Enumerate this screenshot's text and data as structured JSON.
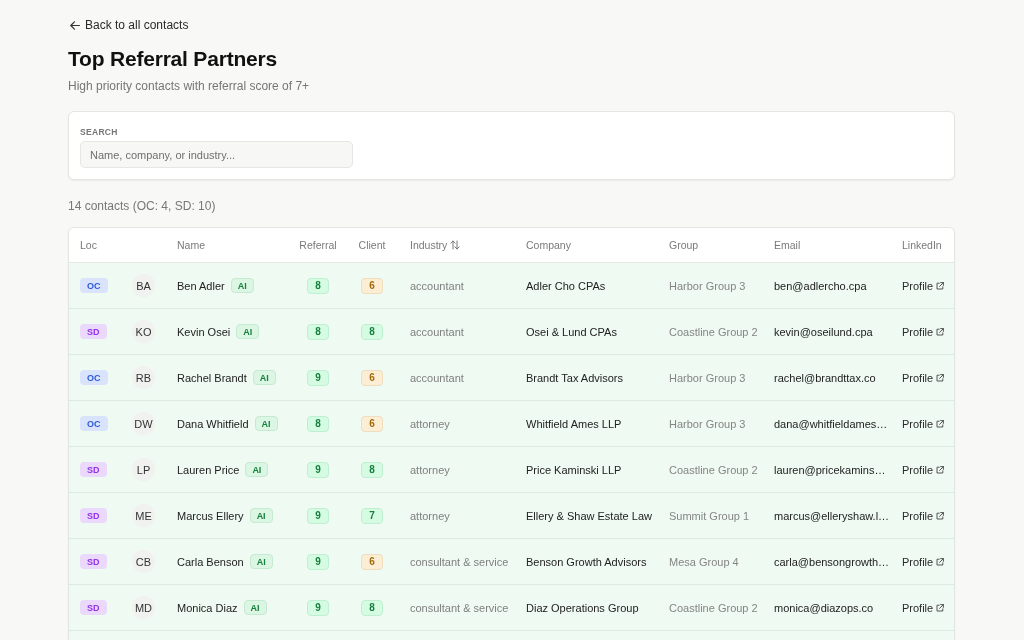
{
  "back_link": {
    "label": "Back to all contacts"
  },
  "title": "Top Referral Partners",
  "subtitle": "High priority contacts with referral score of 7+",
  "search": {
    "label": "SEARCH",
    "placeholder": "Name, company, or industry..."
  },
  "count": "14 contacts (OC: 4, SD: 10)",
  "table": {
    "columns": [
      {
        "label": "Loc",
        "sortable": false
      },
      {
        "label": "Name",
        "sortable": false
      },
      {
        "label": "Referral",
        "sortable": false
      },
      {
        "label": "Client",
        "sortable": false
      },
      {
        "label": "Industry",
        "sortable": true
      },
      {
        "label": "Company",
        "sortable": false
      },
      {
        "label": "Group",
        "sortable": false
      },
      {
        "label": "Email",
        "sortable": false
      },
      {
        "label": "LinkedIn",
        "sortable": false
      }
    ],
    "rows": [
      {
        "loc": {
          "text": "OC",
          "color": "#2d5bd8"
        },
        "initials": "BA",
        "name": "Ben Adler",
        "tag": "AI",
        "referral": {
          "value": "8",
          "color": "#17803d"
        },
        "client": {
          "value": "6",
          "color": "#a26a0a"
        },
        "industry": "accountant",
        "company": "Adler Cho CPAs",
        "group": "Harbor Group 3",
        "email": "ben@adlercho.cpa",
        "linkedin": "Profile"
      },
      {
        "loc": {
          "text": "SD",
          "color": "#9333ea"
        },
        "initials": "KO",
        "name": "Kevin Osei",
        "tag": "AI",
        "referral": {
          "value": "8",
          "color": "#17803d"
        },
        "client": {
          "value": "8",
          "color": "#17803d"
        },
        "industry": "accountant",
        "company": "Osei & Lund CPAs",
        "group": "Coastline Group 2",
        "email": "kevin@oseilund.cpa",
        "linkedin": "Profile"
      },
      {
        "loc": {
          "text": "OC",
          "color": "#2d5bd8"
        },
        "initials": "RB",
        "name": "Rachel Brandt",
        "tag": "AI",
        "referral": {
          "value": "9",
          "color": "#17803d"
        },
        "client": {
          "value": "6",
          "color": "#a26a0a"
        },
        "industry": "accountant",
        "company": "Brandt Tax Advisors",
        "group": "Harbor Group 3",
        "email": "rachel@brandttax.co",
        "linkedin": "Profile"
      },
      {
        "loc": {
          "text": "OC",
          "color": "#2d5bd8"
        },
        "initials": "DW",
        "name": "Dana Whitfield",
        "tag": "AI",
        "referral": {
          "value": "8",
          "color": "#17803d"
        },
        "client": {
          "value": "6",
          "color": "#a26a0a"
        },
        "industry": "attorney",
        "company": "Whitfield Ames LLP",
        "group": "Harbor Group 3",
        "email": "dana@whitfieldames…",
        "linkedin": "Profile"
      },
      {
        "loc": {
          "text": "SD",
          "color": "#9333ea"
        },
        "initials": "LP",
        "name": "Lauren Price",
        "tag": "AI",
        "referral": {
          "value": "9",
          "color": "#17803d"
        },
        "client": {
          "value": "8",
          "color": "#17803d"
        },
        "industry": "attorney",
        "company": "Price Kaminski LLP",
        "group": "Coastline Group 2",
        "email": "lauren@pricekamins…",
        "linkedin": "Profile"
      },
      {
        "loc": {
          "text": "SD",
          "color": "#9333ea"
        },
        "initials": "ME",
        "name": "Marcus Ellery",
        "tag": "AI",
        "referral": {
          "value": "9",
          "color": "#17803d"
        },
        "client": {
          "value": "7",
          "color": "#17803d"
        },
        "industry": "attorney",
        "company": "Ellery & Shaw Estate Law",
        "group": "Summit Group 1",
        "email": "marcus@elleryshaw.l…",
        "linkedin": "Profile"
      },
      {
        "loc": {
          "text": "SD",
          "color": "#9333ea"
        },
        "initials": "CB",
        "name": "Carla Benson",
        "tag": "AI",
        "referral": {
          "value": "9",
          "color": "#17803d"
        },
        "client": {
          "value": "6",
          "color": "#a26a0a"
        },
        "industry": "consultant & service",
        "company": "Benson Growth Advisors",
        "group": "Mesa Group 4",
        "email": "carla@bensongrowth…",
        "linkedin": "Profile"
      },
      {
        "loc": {
          "text": "SD",
          "color": "#9333ea"
        },
        "initials": "MD",
        "name": "Monica Diaz",
        "tag": "AI",
        "referral": {
          "value": "9",
          "color": "#17803d"
        },
        "client": {
          "value": "8",
          "color": "#17803d"
        },
        "industry": "consultant & service",
        "company": "Diaz Operations Group",
        "group": "Coastline Group 2",
        "email": "monica@diazops.co",
        "linkedin": "Profile"
      }
    ]
  }
}
